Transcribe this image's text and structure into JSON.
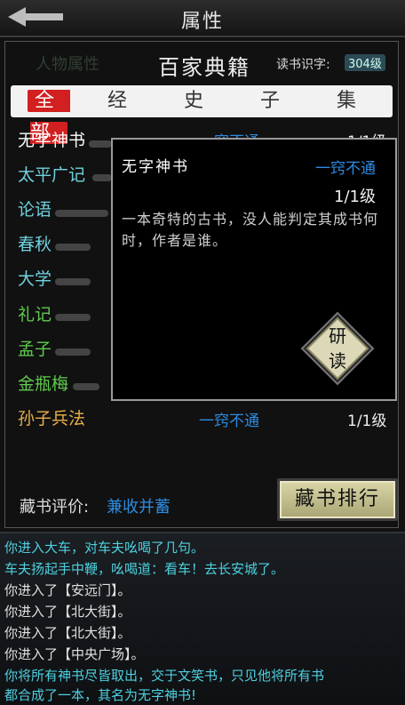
{
  "header": {
    "title": "属性"
  },
  "panel": {
    "ghost_title": "人物属性",
    "title": "百家典籍",
    "reading_label": "读书识字:",
    "reading_value": "304级"
  },
  "tabs": [
    "全 部",
    "经",
    "史",
    "子",
    "集"
  ],
  "books": [
    {
      "name": "无字神书",
      "color": "#ffffff",
      "grade": "一窍不通",
      "level": "1/1级"
    },
    {
      "name": "太平广记",
      "color": "#6fd2e0"
    },
    {
      "name": "论语",
      "color": "#6fd2e0"
    },
    {
      "name": "春秋",
      "color": "#6fd2e0"
    },
    {
      "name": "大学",
      "color": "#6fd2e0"
    },
    {
      "name": "礼记",
      "color": "#5fca4e"
    },
    {
      "name": "孟子",
      "color": "#5fca4e"
    },
    {
      "name": "金瓶梅",
      "color": "#5fca4e"
    },
    {
      "name": "孙子兵法",
      "color": "#e6b04a",
      "grade": "一窍不通",
      "level": "1/1级"
    }
  ],
  "popup": {
    "title": "无字神书",
    "grade": "一窍不通",
    "level": "1/1级",
    "description": "一本奇特的古书，没人能判定其成书何时，作者是谁。",
    "read_button": [
      "研",
      "读"
    ]
  },
  "evaluation": {
    "label": "藏书评价:",
    "value": "兼收并蓄"
  },
  "rank_button": "藏书排行",
  "log": [
    {
      "text": "你进入大车，对车夫吆喝了几句。",
      "color": "#4dd0e0"
    },
    {
      "text": "车夫扬起手中鞭，吆喝道：看车！去长安城了。",
      "color": "#4dd0e0"
    },
    {
      "text": "你进入了【安远门】。",
      "color": "#e0e0e0"
    },
    {
      "text": "你进入了【北大街】。",
      "color": "#e0e0e0"
    },
    {
      "text": "你进入了【北大街】。",
      "color": "#e0e0e0"
    },
    {
      "text": "你进入了【中央广场】。",
      "color": "#e0e0e0"
    },
    {
      "text": "你将所有神书尽皆取出，交于文笑书，只见他将所有书",
      "color": "#4dd0e0"
    },
    {
      "text": "都合成了一本，其名为无字神书!",
      "color": "#4dd0e0"
    }
  ],
  "colors": {
    "accent_red": "#d21f1f",
    "grade_blue": "#2d8be0"
  }
}
